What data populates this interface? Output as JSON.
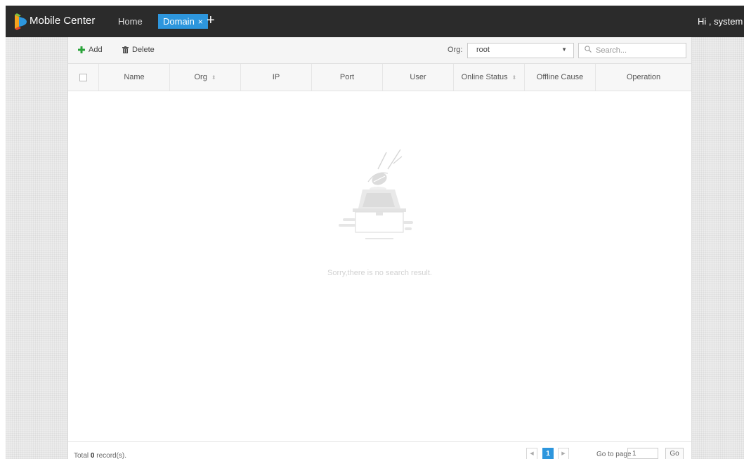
{
  "header": {
    "app_title": "Mobile Center",
    "nav": {
      "home_label": "Home",
      "active_tab_label": "Domain",
      "close_glyph": "×",
      "add_tab_glyph": "+"
    },
    "user_greeting": "Hi , system",
    "user_caret": "▾"
  },
  "toolbar": {
    "add_label": "Add",
    "delete_label": "Delete",
    "org_label": "Org:",
    "org_value": "root",
    "org_caret": "▼",
    "search_placeholder": "Search...",
    "icons": {
      "add": "plus-icon",
      "delete": "trash-icon",
      "search": "search-icon"
    }
  },
  "table": {
    "columns": [
      {
        "label": "",
        "checkbox": true
      },
      {
        "label": "Name"
      },
      {
        "label": "Org",
        "sortable": true
      },
      {
        "label": "IP"
      },
      {
        "label": "Port"
      },
      {
        "label": "User"
      },
      {
        "label": "Online Status",
        "sortable": true
      },
      {
        "label": "Offline Cause"
      },
      {
        "label": "Operation"
      }
    ],
    "sort_glyph": "⬍",
    "rows": [],
    "empty_message": "Sorry,there is no search result."
  },
  "footer": {
    "total_prefix": "Total ",
    "total_count": "0",
    "total_suffix": " record(s).",
    "pagination": {
      "prev_glyph": "◀",
      "current_page": "1",
      "next_glyph": "▶"
    },
    "goto_label": "Go to page",
    "goto_value": "1",
    "go_label": "Go"
  },
  "colors": {
    "topbar": "#2b2b2b",
    "accent": "#2d96dd",
    "add_icon": "#2aa33a"
  }
}
